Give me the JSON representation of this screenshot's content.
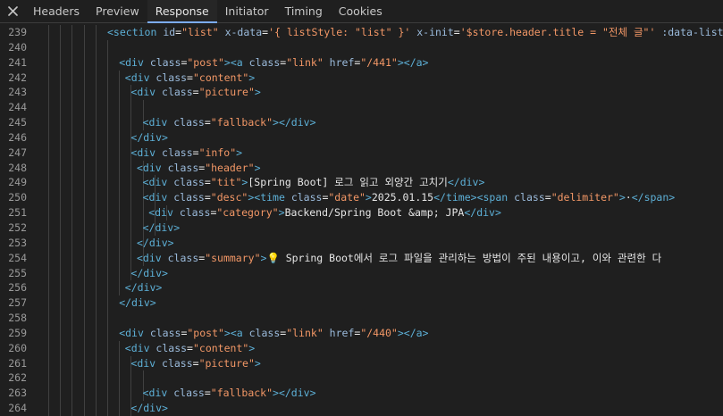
{
  "tabs": [
    {
      "label": "Headers",
      "active": false
    },
    {
      "label": "Preview",
      "active": false
    },
    {
      "label": "Response",
      "active": true
    },
    {
      "label": "Initiator",
      "active": false
    },
    {
      "label": "Timing",
      "active": false
    },
    {
      "label": "Cookies",
      "active": false
    }
  ],
  "icons": {
    "close": "close-icon"
  },
  "colors": {
    "background": "#1f1f1f",
    "tag": "#5db0d7",
    "attribute": "#9bbbdc",
    "string": "#f29766",
    "text": "#e6e6e6",
    "line_number": "#9a9a9a",
    "active_tab_underline": "#7cacf8"
  },
  "lines": [
    {
      "n": "239",
      "indent": 10,
      "guides": 5,
      "tokens": [
        [
          "tag",
          "<section "
        ],
        [
          "attr",
          "id"
        ],
        [
          "txt",
          "="
        ],
        [
          "str",
          "\"list\" "
        ],
        [
          "attr",
          "x-data"
        ],
        [
          "txt",
          "="
        ],
        [
          "str",
          "'{ listStyle: \"list\" }' "
        ],
        [
          "attr",
          "x-init"
        ],
        [
          "txt",
          "="
        ],
        [
          "str",
          "'$store.header.title = \"전체 글\"' "
        ],
        [
          "attr",
          ":data-list-s"
        ]
      ]
    },
    {
      "n": "240",
      "indent": 0,
      "guides": 6,
      "tokens": []
    },
    {
      "n": "241",
      "indent": 12,
      "guides": 6,
      "tokens": [
        [
          "tag",
          "<div "
        ],
        [
          "attr",
          "class"
        ],
        [
          "txt",
          "="
        ],
        [
          "str",
          "\"post\""
        ],
        [
          "tag",
          ">"
        ],
        [
          "tag",
          "<a "
        ],
        [
          "attr",
          "class"
        ],
        [
          "txt",
          "="
        ],
        [
          "str",
          "\"link\" "
        ],
        [
          "attr",
          "href"
        ],
        [
          "txt",
          "="
        ],
        [
          "str",
          "\"/441\""
        ],
        [
          "tag",
          "></a>"
        ]
      ]
    },
    {
      "n": "242",
      "indent": 13,
      "guides": 7,
      "tokens": [
        [
          "tag",
          "<div "
        ],
        [
          "attr",
          "class"
        ],
        [
          "txt",
          "="
        ],
        [
          "str",
          "\"content\""
        ],
        [
          "tag",
          ">"
        ]
      ]
    },
    {
      "n": "243",
      "indent": 14,
      "guides": 8,
      "tokens": [
        [
          "tag",
          "<div "
        ],
        [
          "attr",
          "class"
        ],
        [
          "txt",
          "="
        ],
        [
          "str",
          "\"picture\""
        ],
        [
          "tag",
          ">"
        ]
      ]
    },
    {
      "n": "244",
      "indent": 0,
      "guides": 9,
      "tokens": []
    },
    {
      "n": "245",
      "indent": 16,
      "guides": 9,
      "tokens": [
        [
          "tag",
          "<div "
        ],
        [
          "attr",
          "class"
        ],
        [
          "txt",
          "="
        ],
        [
          "str",
          "\"fallback\""
        ],
        [
          "tag",
          "></div>"
        ]
      ]
    },
    {
      "n": "246",
      "indent": 14,
      "guides": 8,
      "tokens": [
        [
          "tag",
          "</div>"
        ]
      ]
    },
    {
      "n": "247",
      "indent": 14,
      "guides": 8,
      "tokens": [
        [
          "tag",
          "<div "
        ],
        [
          "attr",
          "class"
        ],
        [
          "txt",
          "="
        ],
        [
          "str",
          "\"info\""
        ],
        [
          "tag",
          ">"
        ]
      ]
    },
    {
      "n": "248",
      "indent": 15,
      "guides": 9,
      "tokens": [
        [
          "tag",
          "<div "
        ],
        [
          "attr",
          "class"
        ],
        [
          "txt",
          "="
        ],
        [
          "str",
          "\"header\""
        ],
        [
          "tag",
          ">"
        ]
      ]
    },
    {
      "n": "249",
      "indent": 16,
      "guides": 10,
      "tokens": [
        [
          "tag",
          "<div "
        ],
        [
          "attr",
          "class"
        ],
        [
          "txt",
          "="
        ],
        [
          "str",
          "\"tit\""
        ],
        [
          "tag",
          ">"
        ],
        [
          "txt",
          "[Spring Boot] 로그 읽고 외양간 고치기"
        ],
        [
          "tag",
          "</div>"
        ]
      ]
    },
    {
      "n": "250",
      "indent": 16,
      "guides": 10,
      "tokens": [
        [
          "tag",
          "<div "
        ],
        [
          "attr",
          "class"
        ],
        [
          "txt",
          "="
        ],
        [
          "str",
          "\"desc\""
        ],
        [
          "tag",
          ">"
        ],
        [
          "tag",
          "<time "
        ],
        [
          "attr",
          "class"
        ],
        [
          "txt",
          "="
        ],
        [
          "str",
          "\"date\""
        ],
        [
          "tag",
          ">"
        ],
        [
          "txt",
          "2025.01.15"
        ],
        [
          "tag",
          "</time>"
        ],
        [
          "tag",
          "<span "
        ],
        [
          "attr",
          "class"
        ],
        [
          "txt",
          "="
        ],
        [
          "str",
          "\"delimiter\""
        ],
        [
          "tag",
          ">"
        ],
        [
          "txt",
          "·"
        ],
        [
          "tag",
          "</span>"
        ]
      ]
    },
    {
      "n": "251",
      "indent": 17,
      "guides": 11,
      "tokens": [
        [
          "tag",
          "<div "
        ],
        [
          "attr",
          "class"
        ],
        [
          "txt",
          "="
        ],
        [
          "str",
          "\"category\""
        ],
        [
          "tag",
          ">"
        ],
        [
          "txt",
          "Backend/Spring Boot &amp; JPA"
        ],
        [
          "tag",
          "</div>"
        ]
      ]
    },
    {
      "n": "252",
      "indent": 16,
      "guides": 10,
      "tokens": [
        [
          "tag",
          "</div>"
        ]
      ]
    },
    {
      "n": "253",
      "indent": 15,
      "guides": 9,
      "tokens": [
        [
          "tag",
          "</div>"
        ]
      ]
    },
    {
      "n": "254",
      "indent": 15,
      "guides": 9,
      "tokens": [
        [
          "tag",
          "<div "
        ],
        [
          "attr",
          "class"
        ],
        [
          "txt",
          "="
        ],
        [
          "str",
          "\"summary\""
        ],
        [
          "tag",
          ">"
        ],
        [
          "bulb",
          "💡 "
        ],
        [
          "txt",
          "Spring Boot에서 로그 파일을 관리하는 방법이 주된 내용이고, 이와 관련한 다"
        ]
      ]
    },
    {
      "n": "255",
      "indent": 14,
      "guides": 8,
      "tokens": [
        [
          "tag",
          "</div>"
        ]
      ]
    },
    {
      "n": "256",
      "indent": 13,
      "guides": 7,
      "tokens": [
        [
          "tag",
          "</div>"
        ]
      ]
    },
    {
      "n": "257",
      "indent": 12,
      "guides": 6,
      "tokens": [
        [
          "tag",
          "</div>"
        ]
      ]
    },
    {
      "n": "258",
      "indent": 0,
      "guides": 6,
      "tokens": []
    },
    {
      "n": "259",
      "indent": 12,
      "guides": 6,
      "tokens": [
        [
          "tag",
          "<div "
        ],
        [
          "attr",
          "class"
        ],
        [
          "txt",
          "="
        ],
        [
          "str",
          "\"post\""
        ],
        [
          "tag",
          ">"
        ],
        [
          "tag",
          "<a "
        ],
        [
          "attr",
          "class"
        ],
        [
          "txt",
          "="
        ],
        [
          "str",
          "\"link\" "
        ],
        [
          "attr",
          "href"
        ],
        [
          "txt",
          "="
        ],
        [
          "str",
          "\"/440\""
        ],
        [
          "tag",
          "></a>"
        ]
      ]
    },
    {
      "n": "260",
      "indent": 13,
      "guides": 7,
      "tokens": [
        [
          "tag",
          "<div "
        ],
        [
          "attr",
          "class"
        ],
        [
          "txt",
          "="
        ],
        [
          "str",
          "\"content\""
        ],
        [
          "tag",
          ">"
        ]
      ]
    },
    {
      "n": "261",
      "indent": 14,
      "guides": 8,
      "tokens": [
        [
          "tag",
          "<div "
        ],
        [
          "attr",
          "class"
        ],
        [
          "txt",
          "="
        ],
        [
          "str",
          "\"picture\""
        ],
        [
          "tag",
          ">"
        ]
      ]
    },
    {
      "n": "262",
      "indent": 0,
      "guides": 9,
      "tokens": []
    },
    {
      "n": "263",
      "indent": 16,
      "guides": 9,
      "tokens": [
        [
          "tag",
          "<div "
        ],
        [
          "attr",
          "class"
        ],
        [
          "txt",
          "="
        ],
        [
          "str",
          "\"fallback\""
        ],
        [
          "tag",
          "></div>"
        ]
      ]
    },
    {
      "n": "264",
      "indent": 14,
      "guides": 8,
      "tokens": [
        [
          "tag",
          "</div>"
        ]
      ]
    }
  ]
}
